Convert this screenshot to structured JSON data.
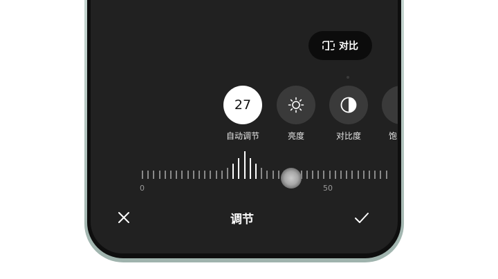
{
  "compare": {
    "label": "对比",
    "icon": "split-compare-icon"
  },
  "tools": [
    {
      "label": "自动调节",
      "value": "27",
      "selected": true
    },
    {
      "label": "亮度",
      "icon": "brightness-icon"
    },
    {
      "label": "对比度",
      "icon": "contrast-icon"
    },
    {
      "label": "饱",
      "icon": "partial-tool-icon"
    }
  ],
  "slider": {
    "min_label": "0",
    "mid_label": "50",
    "value": 27
  },
  "bottom_bar": {
    "title": "调节",
    "close_icon": "close-icon",
    "confirm_icon": "check-icon"
  },
  "colors": {
    "screen_bg": "#212121",
    "pill_bg": "#0c0c0c",
    "selected_bg": "#ffffff"
  }
}
